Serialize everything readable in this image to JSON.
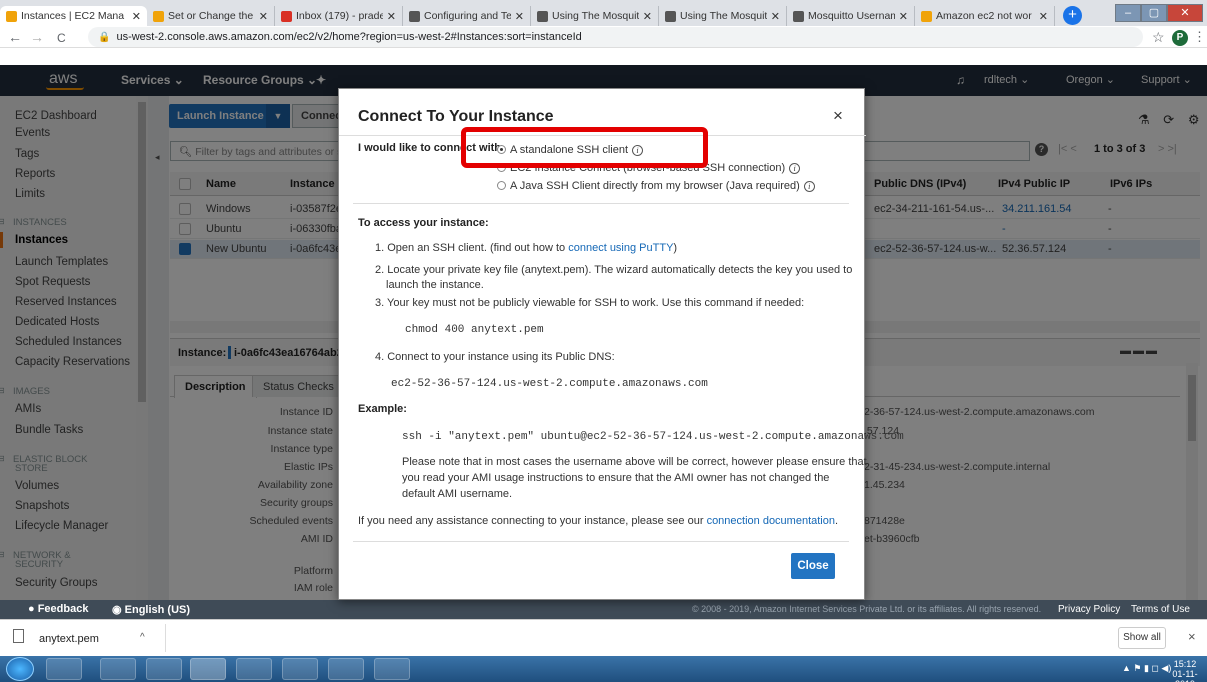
{
  "browser": {
    "tabs": [
      {
        "label": "Instances | EC2 Mana",
        "color": "#f0a30a"
      },
      {
        "label": "Set or Change the Re",
        "color": "#f0a30a"
      },
      {
        "label": "Inbox (179) - pradee",
        "color": "#d93025"
      },
      {
        "label": "Configuring and Test",
        "color": "#555555"
      },
      {
        "label": "Using The Mosquitto",
        "color": "#555555"
      },
      {
        "label": "Using The Mosquitto",
        "color": "#555555"
      },
      {
        "label": "Mosquitto Username",
        "color": "#555555"
      },
      {
        "label": "Amazon ec2 not wor",
        "color": "#f0a30a"
      }
    ],
    "new_tab": "+",
    "url": "us-west-2.console.aws.amazon.com/ec2/v2/home?region=us-west-2#Instances:sort=instanceId",
    "profile_initial": "P",
    "star": "☆",
    "menu": "⋮",
    "back": "←",
    "forward": "→",
    "reload": "C"
  },
  "awsnav": {
    "logo": "aws",
    "services": "Services ⌄",
    "resource_groups": "Resource Groups ⌄",
    "pin": "✦",
    "bell": "♫",
    "user": "rdltech ⌄",
    "region": "Oregon ⌄",
    "support": "Support ⌄"
  },
  "sidebar": {
    "items": [
      {
        "label": "EC2 Dashboard",
        "type": "item"
      },
      {
        "label": "Events",
        "type": "item"
      },
      {
        "label": "Tags",
        "type": "item"
      },
      {
        "label": "Reports",
        "type": "item"
      },
      {
        "label": "Limits",
        "type": "item"
      },
      {
        "label": "INSTANCES",
        "type": "head"
      },
      {
        "label": "Instances",
        "type": "sel"
      },
      {
        "label": "Launch Templates",
        "type": "item"
      },
      {
        "label": "Spot Requests",
        "type": "item"
      },
      {
        "label": "Reserved Instances",
        "type": "item"
      },
      {
        "label": "Dedicated Hosts",
        "type": "item"
      },
      {
        "label": "Scheduled Instances",
        "type": "item"
      },
      {
        "label": "Capacity Reservations",
        "type": "item"
      },
      {
        "label": "IMAGES",
        "type": "head"
      },
      {
        "label": "AMIs",
        "type": "item"
      },
      {
        "label": "Bundle Tasks",
        "type": "item"
      },
      {
        "label": "ELASTIC BLOCK",
        "type": "head"
      },
      {
        "label": "STORE",
        "type": "head2"
      },
      {
        "label": "Volumes",
        "type": "item"
      },
      {
        "label": "Snapshots",
        "type": "item"
      },
      {
        "label": "Lifecycle Manager",
        "type": "item"
      },
      {
        "label": "NETWORK &",
        "type": "head"
      },
      {
        "label": "SECURITY",
        "type": "head2"
      },
      {
        "label": "Security Groups",
        "type": "item"
      }
    ]
  },
  "toolbar": {
    "launch": "Launch Instance",
    "caret": "▼",
    "connect": "Connect",
    "filter_placeholder": "Filter by tags and attributes or se",
    "pagination": "1 to 3 of 3",
    "help": "?"
  },
  "table": {
    "headers": [
      "Name",
      "Instance I",
      "Public DNS (IPv4)",
      "IPv4 Public IP",
      "IPv6 IPs"
    ],
    "rows": [
      {
        "name": "Windows",
        "id": "i-03587f2e",
        "dns": "ec2-34-211-161-54.us-...",
        "ip": "34.211.161.54",
        "ipv6": "-",
        "selected": false
      },
      {
        "name": "Ubuntu",
        "id": "i-06330fba",
        "dns": "",
        "ip": "-",
        "ipv6": "-",
        "selected": false
      },
      {
        "name": "New Ubuntu",
        "id": "i-0a6fc43ea",
        "dns": "ec2-52-36-57-124.us-w...",
        "ip": "52.36.57.124",
        "ipv6": "-",
        "selected": true
      }
    ]
  },
  "details": {
    "instance_label": "Instance:",
    "instance_id": "i-0a6fc43ea16764ab2",
    "tabs": [
      "Description",
      "Status Checks"
    ],
    "labels": [
      "Instance ID",
      "Instance state",
      "Instance type",
      "Elastic IPs",
      "Availability zone",
      "Security groups",
      "Scheduled events",
      "AMI ID",
      "Platform",
      "IAM role"
    ],
    "values": [
      "2-36-57-124.us-west-2.compute.amazonaws.com",
      ".57.124",
      "",
      "2-31-45-234.us-west-2.compute.internal",
      "1.45.234",
      "",
      "871428e",
      "et-b3960cfb"
    ]
  },
  "modal": {
    "title": "Connect To Your Instance",
    "close_x": "×",
    "connect_with": "I would like to connect with",
    "options": [
      {
        "label": "A standalone SSH client",
        "checked": true
      },
      {
        "label": "EC2 Instance Connect (browser-based SSH connection)",
        "checked": false
      },
      {
        "label": "A Java SSH Client directly from my browser (Java required)",
        "checked": false
      }
    ],
    "info_glyph": "i",
    "access_heading": "To access your instance:",
    "step1_pre": "1. Open an SSH client. (find out how to ",
    "step1_link": "connect using PuTTY",
    "step1_post": ")",
    "step2_line1": "2. Locate your private key file (anytext.pem). The wizard automatically detects the key you used to",
    "step2_line2": "launch the instance.",
    "step3": "3. Your key must not be publicly viewable for SSH to work. Use this command if needed:",
    "chmod": "chmod 400 anytext.pem",
    "step4": "4. Connect to your instance using its Public DNS:",
    "dns": "ec2-52-36-57-124.us-west-2.compute.amazonaws.com",
    "example_heading": "Example:",
    "ssh_cmd": "ssh -i \"anytext.pem\" ubuntu@ec2-52-36-57-124.us-west-2.compute.amazonaws.com",
    "note_line1": "Please note that in most cases the username above will be correct, however please ensure that",
    "note_line2": "you read your AMI usage instructions to ensure that the AMI owner has not changed the",
    "note_line3": "default AMI username.",
    "assist_pre": "If you need any assistance connecting to your instance, please see our ",
    "assist_link": "connection documentation",
    "assist_post": ".",
    "close_button": "Close"
  },
  "footer": {
    "feedback": "Feedback",
    "language": "English (US)",
    "copyright": "© 2008 - 2019, Amazon Internet Services Private Ltd. or its affiliates. All rights reserved.",
    "privacy": "Privacy Policy",
    "terms": "Terms of Use"
  },
  "downloads": {
    "file": "anytext.pem",
    "chevron": "^",
    "show_all": "Show all",
    "close": "×"
  },
  "taskbar": {
    "time": "15:12",
    "date": "01-11-2019"
  },
  "colors": {
    "aws_nav": "#232f3e",
    "primary_button": "#2274c2",
    "highlight": "#e30000"
  }
}
